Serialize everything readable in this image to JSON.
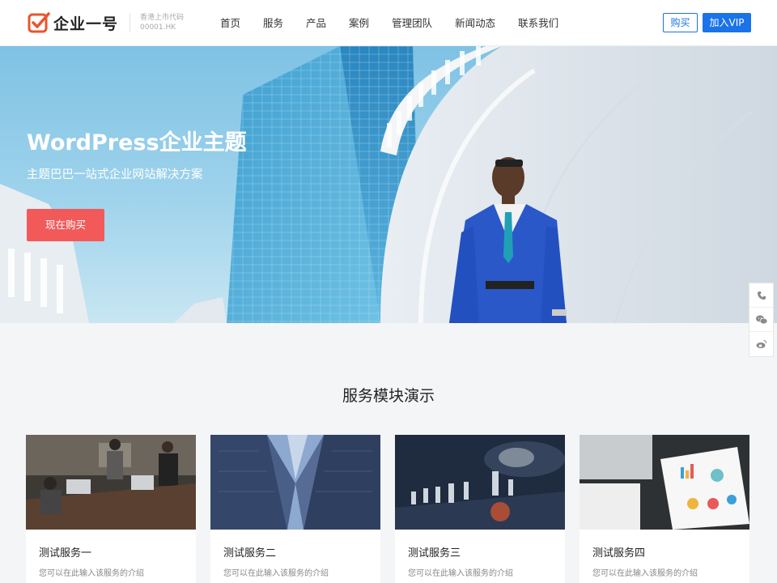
{
  "header": {
    "logo_text": "企业一号",
    "stock_label": "香港上市代码",
    "stock_code": "00001.HK",
    "nav": [
      "首页",
      "服务",
      "产品",
      "案例",
      "管理团队",
      "新闻动态",
      "联系我们"
    ],
    "buy_label": "购买",
    "vip_label": "加入VIP"
  },
  "hero": {
    "title": "WordPress企业主题",
    "subtitle": "主题巴巴一站式企业网站解决方案",
    "button_label": "现在购买"
  },
  "float_bar": {
    "items": [
      "phone-icon",
      "wechat-icon",
      "weibo-icon"
    ]
  },
  "services": {
    "title": "服务模块演示",
    "cards": [
      {
        "title": "测试服务一",
        "desc": "您可以在此输入该服务的介绍"
      },
      {
        "title": "测试服务二",
        "desc": "您可以在此输入该服务的介绍"
      },
      {
        "title": "测试服务三",
        "desc": "您可以在此输入该服务的介绍"
      },
      {
        "title": "测试服务四",
        "desc": "您可以在此输入该服务的介绍"
      }
    ]
  },
  "colors": {
    "accent": "#1a73e8",
    "hero_button": "#f25a5a",
    "logo": "#e8552d"
  }
}
